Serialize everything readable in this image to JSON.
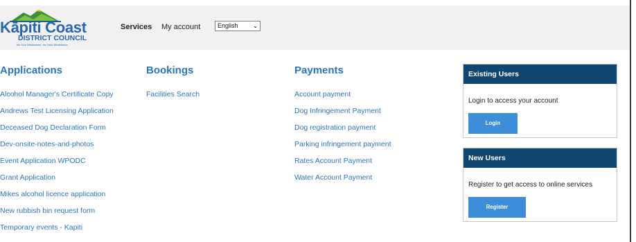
{
  "header": {
    "logo": {
      "name": "Kāpiti Coast",
      "council": "DISTRICT COUNCIL",
      "tagline": "Me Huri Whakamuri, Ka Titiro Whakamua"
    },
    "nav": {
      "services_label": "Services",
      "account_label": "My account"
    },
    "language_select": {
      "value": "English"
    }
  },
  "columns": {
    "applications": {
      "heading": "Applications",
      "links": [
        "Alcohol Manager's Certificate Copy",
        "Andrews Test Licensing Application",
        "Deceased Dog Declaration Form",
        "Dev-onsite-notes-and-photos",
        "Event Application WPODC",
        "Grant Application",
        "Mikes alcohol licence application",
        "New rubbish bin request form",
        "Temporary events - Kapiti"
      ]
    },
    "bookings": {
      "heading": "Bookings",
      "links": [
        "Facilities Search"
      ]
    },
    "payments": {
      "heading": "Payments",
      "links": [
        "Account payment",
        "Dog Infringement Payment",
        "Dog registration payment",
        "Parking infringement payment",
        "Rates Account Payment",
        "Water Account Payment"
      ]
    }
  },
  "existing_users": {
    "title": "Existing Users",
    "text": "Login to access your account",
    "button": "Login"
  },
  "new_users": {
    "title": "New Users",
    "text": "Register to get access to online services",
    "button": "Register"
  },
  "colors": {
    "link_blue": "#2a74bd",
    "panel_header": "#0f4772",
    "button_blue": "#3d8ed8",
    "header_bg": "#f1f1f1"
  }
}
